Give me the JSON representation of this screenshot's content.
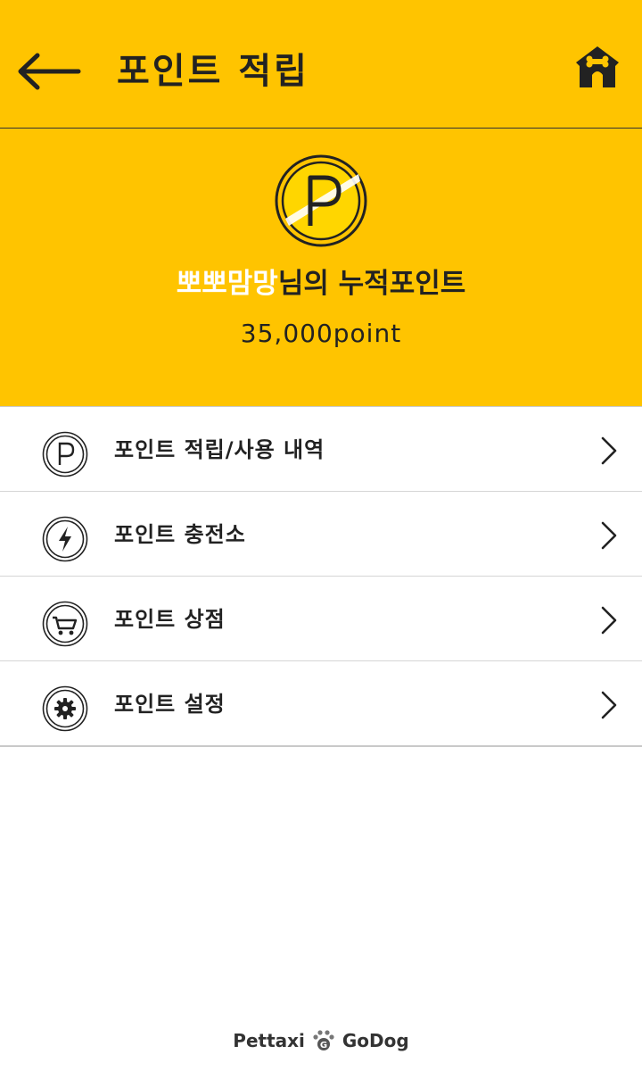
{
  "header": {
    "title": "포인트 적립",
    "back_icon": "arrow-left-icon",
    "home_icon": "dog-house-icon"
  },
  "summary": {
    "coin_icon": "point-coin-icon",
    "nickname": "뽀뽀맘망",
    "title_suffix": "님의 누적포인트",
    "points": "35,000point"
  },
  "menu": {
    "items": [
      {
        "label": "포인트 적립/사용 내역",
        "icon": "point-history-icon"
      },
      {
        "label": "포인트 충전소",
        "icon": "lightning-icon"
      },
      {
        "label": "포인트 상점",
        "icon": "cart-icon"
      },
      {
        "label": "포인트 설정",
        "icon": "gear-icon"
      }
    ]
  },
  "footer": {
    "brand_left": "Pettaxi",
    "brand_right": "GoDog"
  },
  "colors": {
    "accent": "#FFC400",
    "nickname": "#FFFFFF",
    "text": "#222222"
  }
}
